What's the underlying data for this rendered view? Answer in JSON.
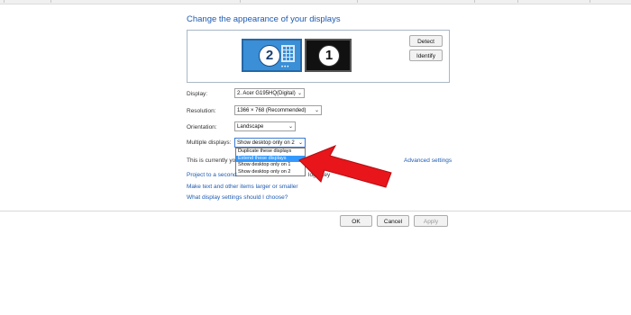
{
  "page": {
    "title": "Change the appearance of your displays"
  },
  "monitors": {
    "primary_label": "2",
    "secondary_label": "1"
  },
  "buttons": {
    "detect": "Detect",
    "identify": "Identify",
    "ok": "OK",
    "cancel": "Cancel",
    "apply": "Apply"
  },
  "settings": {
    "display": {
      "label": "Display:",
      "value": "2. Acer G195HQ(Digital)"
    },
    "resolution": {
      "label": "Resolution:",
      "value": "1366 × 768 (Recommended)"
    },
    "orientation": {
      "label": "Orientation:",
      "value": "Landscape"
    },
    "multiple_displays": {
      "label": "Multiple displays:",
      "value": "Show desktop only on 2",
      "options": [
        "Duplicate these displays",
        "Extend these displays",
        "Show desktop only on 1",
        "Show desktop only on 2"
      ],
      "highlighted_index": 1
    }
  },
  "info": {
    "current_text": "This is currently yo",
    "project_text": "Project to a second",
    "logo_text": "logo key",
    "advanced_link": "Advanced settings"
  },
  "links": {
    "larger_text": "Make text and other items larger or smaller",
    "which_settings": "What display settings should I choose?"
  },
  "colors": {
    "accent": "#1e5bb0",
    "highlight": "#3399ff",
    "annotation_arrow": "#e8161b"
  }
}
